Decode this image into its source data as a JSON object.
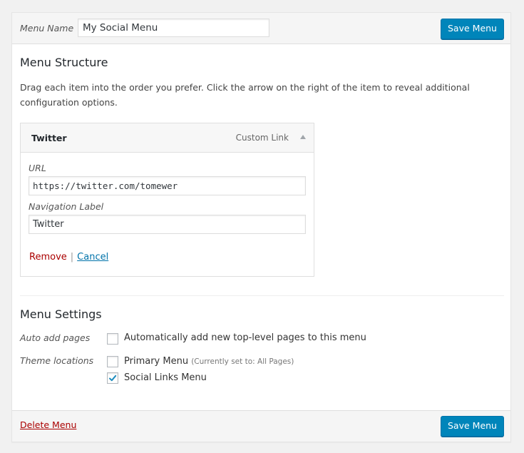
{
  "header": {
    "menu_name_label": "Menu Name",
    "menu_name_value": "My Social Menu",
    "save_label": "Save Menu"
  },
  "structure": {
    "title": "Menu Structure",
    "description": "Drag each item into the order you prefer. Click the arrow on the right of the item to reveal additional configuration options.",
    "items": [
      {
        "title": "Twitter",
        "type": "Custom Link",
        "expanded": true,
        "url_label": "URL",
        "url_value": "https://twitter.com/tomewer",
        "nav_label_label": "Navigation Label",
        "nav_label_value": "Twitter",
        "remove_label": "Remove",
        "separator": "|",
        "cancel_label": "Cancel"
      }
    ]
  },
  "settings": {
    "title": "Menu Settings",
    "auto_add_label": "Auto add pages",
    "auto_add_option": {
      "label": "Automatically add new top-level pages to this menu",
      "checked": false
    },
    "theme_locations_label": "Theme locations",
    "locations": [
      {
        "label": "Primary Menu",
        "note": "(Currently set to: All Pages)",
        "checked": false
      },
      {
        "label": "Social Links Menu",
        "note": "",
        "checked": true
      }
    ]
  },
  "footer": {
    "delete_label": "Delete Menu",
    "save_label": "Save Menu"
  },
  "colors": {
    "primary_button": "#0085ba",
    "delete_link": "#aa0000",
    "cancel_link": "#0073aa",
    "checkmark": "#1e8cbe"
  }
}
